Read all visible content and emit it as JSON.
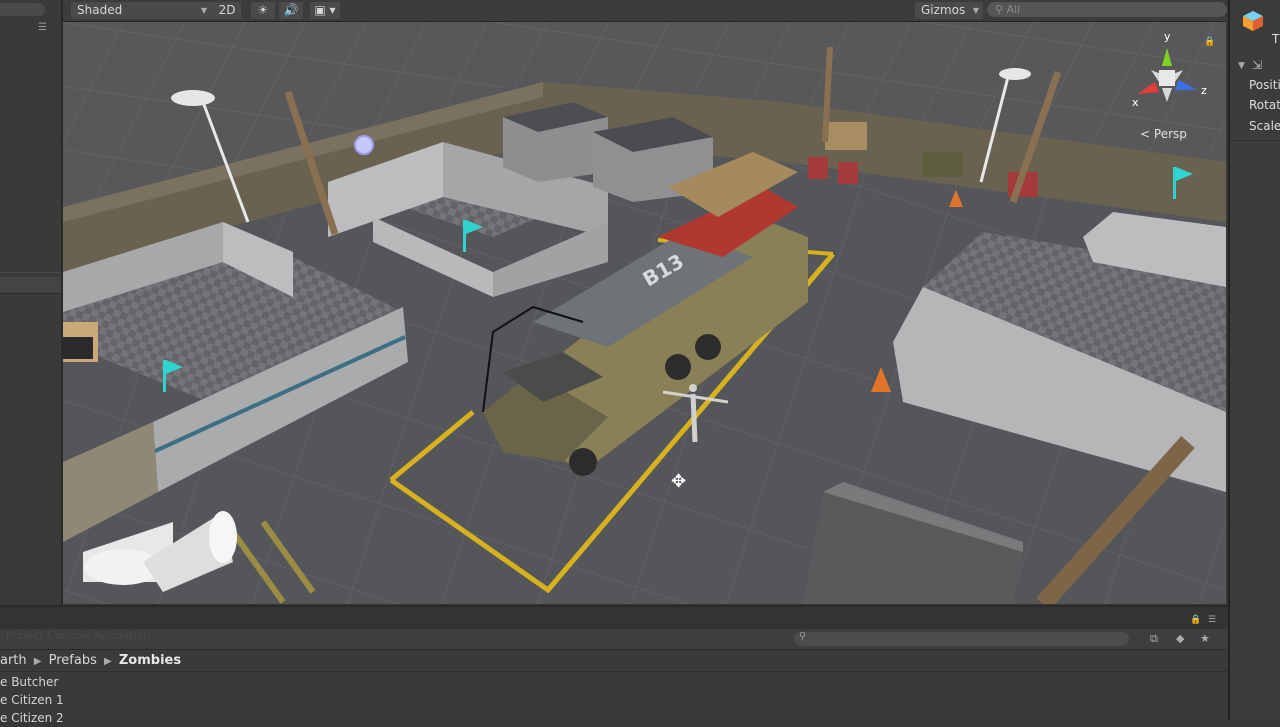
{
  "scene_toolbar": {
    "shading_mode": "Shaded",
    "mode_2d": "2D",
    "light_icon": "sun-icon",
    "audio_icon": "speaker-icon",
    "effects_icon": "image-icon",
    "gizmos_label": "Gizmos",
    "search_placeholder": "All"
  },
  "scene": {
    "truck_plate": "B13",
    "projection_label": "Persp",
    "gizmo_axes": {
      "y": "y",
      "x": "x",
      "z": "z"
    },
    "parking_line_color": "#d8b21e",
    "flag_color": "#2fd4cf"
  },
  "inspector": {
    "title_fragment": "T",
    "fields": [
      "Positi",
      "Rotat",
      "Scale"
    ]
  },
  "project": {
    "tab_ghost": "Project   Console   Animation",
    "breadcrumb": [
      "arth",
      "Prefabs",
      "Zombies"
    ],
    "files": [
      "e Butcher",
      "e Citizen 1",
      "e Citizen 2"
    ]
  }
}
